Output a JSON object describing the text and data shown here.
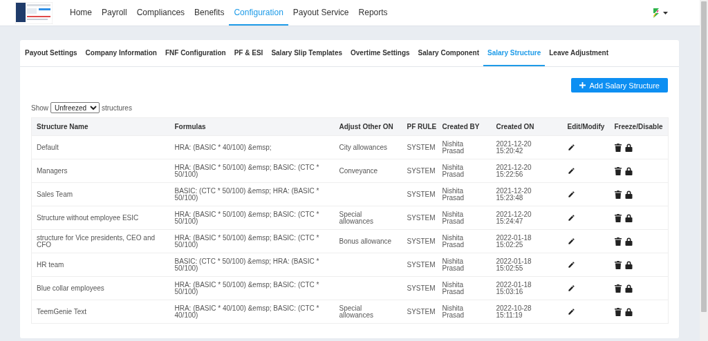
{
  "nav": {
    "items": [
      {
        "label": "Home",
        "selected": false
      },
      {
        "label": "Payroll",
        "selected": false
      },
      {
        "label": "Compliances",
        "selected": false
      },
      {
        "label": "Benefits",
        "selected": false
      },
      {
        "label": "Configuration",
        "selected": true
      },
      {
        "label": "Payout Service",
        "selected": false
      },
      {
        "label": "Reports",
        "selected": false
      }
    ]
  },
  "tabs": [
    {
      "label": "Payout Settings",
      "selected": false
    },
    {
      "label": "Company Information",
      "selected": false
    },
    {
      "label": "FNF Configuration",
      "selected": false
    },
    {
      "label": "PF & ESI",
      "selected": false
    },
    {
      "label": "Salary Slip Templates",
      "selected": false
    },
    {
      "label": "Overtime Settings",
      "selected": false
    },
    {
      "label": "Salary Component",
      "selected": false
    },
    {
      "label": "Salary Structure",
      "selected": true
    },
    {
      "label": "Leave Adjustment",
      "selected": false
    }
  ],
  "add_button": {
    "label": "Add Salary Structure"
  },
  "filter": {
    "prefix": "Show",
    "value": "Unfreezed",
    "suffix": "structures"
  },
  "table": {
    "columns": [
      "Structure Name",
      "Formulas",
      "Adjust Other ON",
      "PF RULE",
      "Created BY",
      "Created ON",
      "Edit/Modify",
      "Freeze/Disable"
    ],
    "rows": [
      {
        "name": "Default",
        "formulas": "HRA: (BASIC * 40/100) &emsp;",
        "adjust": "City allowances",
        "pf_rule": "SYSTEM",
        "created_by": "Nishita Prasad",
        "created_on": "2021-12-20 15:20:42"
      },
      {
        "name": "Managers",
        "formulas": "HRA: (BASIC * 50/100) &emsp; BASIC: (CTC * 50/100)",
        "adjust": "Conveyance",
        "pf_rule": "SYSTEM",
        "created_by": "Nishita Prasad",
        "created_on": "2021-12-20 15:22:56"
      },
      {
        "name": "Sales Team",
        "formulas": "BASIC: (CTC * 50/100) &emsp; HRA: (BASIC * 50/100)",
        "pf_rule": "SYSTEM",
        "created_by": "Nishita Prasad",
        "created_on": "2021-12-20 15:23:48"
      },
      {
        "name": "Structure without employee ESIC",
        "formulas": "HRA: (BASIC * 50/100) &emsp; BASIC: (CTC * 50/100)",
        "adjust": "Special allowances",
        "pf_rule": "SYSTEM",
        "created_by": "Nishita Prasad",
        "created_on": "2021-12-20 15:24:47"
      },
      {
        "name": "structure for Vice presidents, CEO and CFO",
        "formulas": "HRA: (BASIC * 50/100) &emsp; BASIC: (CTC * 50/100)",
        "adjust": "Bonus allowance",
        "pf_rule": "SYSTEM",
        "created_by": "Nishita Prasad",
        "created_on": "2022-01-18 15:02:25"
      },
      {
        "name": "HR team",
        "formulas": "BASIC: (CTC * 50/100) &emsp; HRA: (BASIC * 50/100)",
        "pf_rule": "SYSTEM",
        "created_by": "Nishita Prasad",
        "created_on": "2022-01-18 15:02:55"
      },
      {
        "name": "Blue collar employees",
        "formulas": "HRA: (BASIC * 50/100) &emsp; BASIC: (CTC * 50/100)",
        "pf_rule": "SYSTEM",
        "created_by": "Nishita Prasad",
        "created_on": "2022-01-18 15:03:16"
      },
      {
        "name": "TeemGenie Text",
        "formulas": "HRA: (BASIC * 40/100) &emsp; BASIC: (CTC * 40/100)",
        "adjust": "Special allowances",
        "pf_rule": "SYSTEM",
        "created_by": "Nishita Prasad",
        "created_on": "2022-10-28 15:11:19"
      }
    ]
  }
}
